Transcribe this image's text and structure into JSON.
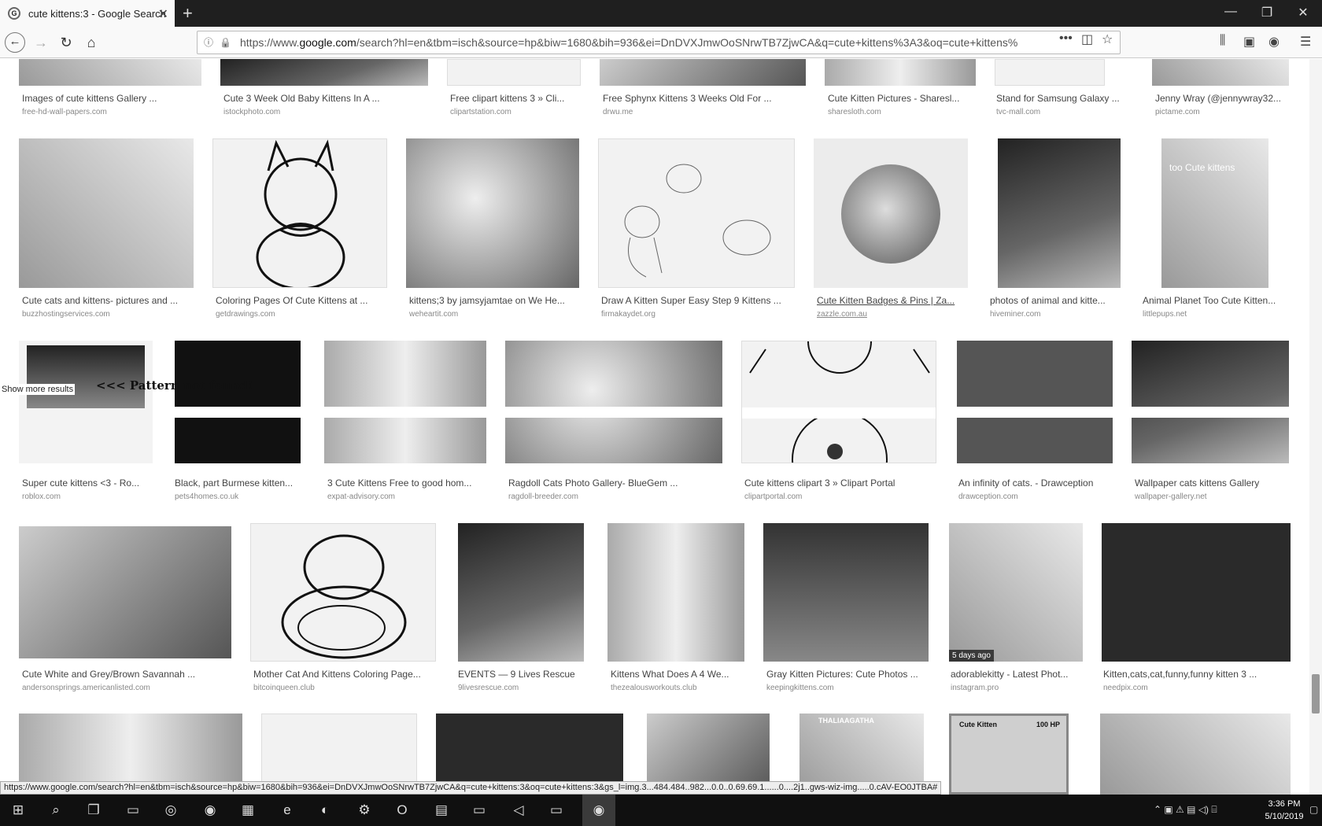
{
  "tab": {
    "title": "cute kittens:3 - Google Search",
    "favicon": "G"
  },
  "url": {
    "prefix": "https://www.",
    "host": "google.com",
    "rest": "/search?hl=en&tbm=isch&source=hp&biw=1680&bih=936&ei=DnDVXJmwOoSNrwTB7ZjwCA&q=cute+kittens%3A3&oq=cute+kittens%"
  },
  "results": {
    "row0": [
      {
        "caption": "Images of cute kittens Gallery ...",
        "source": "free-hd-wall-papers.com"
      },
      {
        "caption": "Cute 3 Week Old Baby Kittens In A ...",
        "source": "istockphoto.com"
      },
      {
        "caption": "Free clipart kittens 3 » Cli...",
        "source": "clipartstation.com"
      },
      {
        "caption": "Free Sphynx Kittens 3 Weeks Old For ...",
        "source": "drwu.me"
      },
      {
        "caption": "Cute Kitten Pictures - Sharesl...",
        "source": "sharesloth.com"
      },
      {
        "caption": "Stand for Samsung Galaxy ...",
        "source": "tvc-mall.com"
      },
      {
        "caption": "Jenny Wray (@jennywray32...",
        "source": "pictame.com"
      }
    ],
    "row1": [
      {
        "caption": "Cute cats and kittens- pictures and ...",
        "source": "buzzhostingservices.com"
      },
      {
        "caption": "Coloring Pages Of Cute Kittens at ...",
        "source": "getdrawings.com"
      },
      {
        "caption": "kittens;3 by jamsyjamtae on We He...",
        "source": "weheartit.com"
      },
      {
        "caption": "Draw A Kitten Super Easy Step 9 Kittens ...",
        "source": "firmakaydet.org"
      },
      {
        "caption": "Cute Kitten Badges & Pins | Za...",
        "source": "zazzle.com.au"
      },
      {
        "caption": "photos of animal and kitte...",
        "source": "hiveminer.com"
      },
      {
        "caption": "Animal Planet Too Cute Kitten...",
        "source": "littlepups.net"
      }
    ],
    "row2": [
      {
        "caption": "Super cute kittens <3 - Ro...",
        "source": "roblox.com"
      },
      {
        "caption": "Black, part Burmese kitten...",
        "source": "pets4homes.co.uk"
      },
      {
        "caption": "3 Cute Kittens Free to good hom...",
        "source": "expat-advisory.com"
      },
      {
        "caption": "Ragdoll Cats Photo Gallery- BlueGem ...",
        "source": "ragdoll-breeder.com"
      },
      {
        "caption": "Cute kittens clipart 3 » Clipart Portal",
        "source": "clipartportal.com"
      },
      {
        "caption": "An infinity of cats. - Drawception",
        "source": "drawception.com"
      },
      {
        "caption": "Wallpaper cats kittens Gallery",
        "source": "wallpaper-gallery.net"
      }
    ],
    "row3": [
      {
        "caption": "Cute White and Grey/Brown Savannah ...",
        "source": "andersonsprings.americanlisted.com"
      },
      {
        "caption": "Mother Cat And Kittens Coloring Page...",
        "source": "bitcoinqueen.club"
      },
      {
        "caption": "EVENTS — 9 Lives Rescue",
        "source": "9livesrescue.com"
      },
      {
        "caption": "Kittens What Does A 4 We...",
        "source": "thezealousworkouts.club"
      },
      {
        "caption": "Gray Kitten Pictures: Cute Photos ...",
        "source": "keepingkittens.com"
      },
      {
        "caption": "adorablekitty - Latest Phot...",
        "source": "instagram.pro"
      },
      {
        "caption": "Kitten,cats,cat,funny,funny kitten 3 ...",
        "source": "needpix.com"
      }
    ],
    "too_cute_text": "too Cute kittens",
    "badge_5_days": "5 days ago",
    "cute_kitten_card": "Cute Kitten",
    "card_hp": "100 HP",
    "thalia_text": "THALIAAGATHA"
  },
  "overlay": {
    "show_more": "Show more results",
    "pattern": "<<< Pattern not found!"
  },
  "status_url": "https://www.google.com/search?hl=en&tbm=isch&source=hp&biw=1680&bih=936&ei=DnDVXJmwOoSNrwTB7ZjwCA&q=cute+kittens:3&oq=cute+kittens:3&gs_l=img.3...484.484..982...0.0..0.69.69.1......0....2j1..gws-wiz-img.....0.cAV-EO0JTBA#",
  "clock": {
    "time": "3:36 PM",
    "date": "5/10/2019"
  }
}
